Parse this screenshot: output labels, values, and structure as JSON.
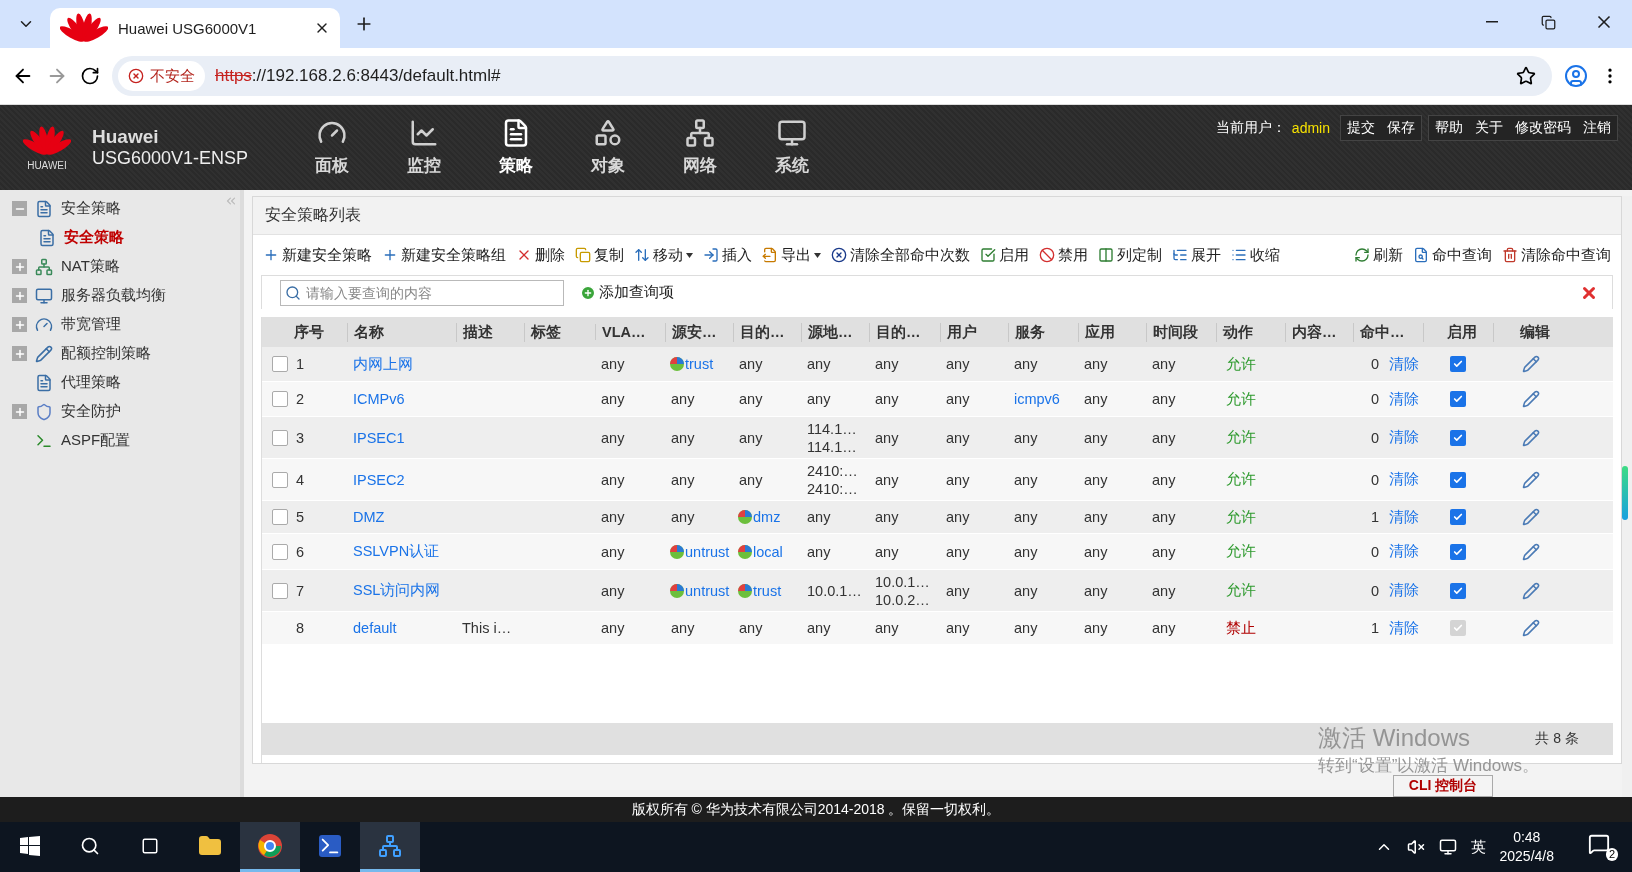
{
  "browser": {
    "tab": {
      "title": "Huawei USG6000V1"
    },
    "security_label": "不安全",
    "url_scheme": "https",
    "url_rest": "://192.168.2.6:8443/default.html#"
  },
  "header": {
    "brand": "Huawei",
    "logo_caption": "HUAWEI",
    "model": "USG6000V1-ENSP",
    "nav": [
      {
        "label": "面板",
        "selected": false
      },
      {
        "label": "监控",
        "selected": false
      },
      {
        "label": "策略",
        "selected": true
      },
      {
        "label": "对象",
        "selected": false
      },
      {
        "label": "网络",
        "selected": false
      },
      {
        "label": "系统",
        "selected": false
      }
    ],
    "user_label": "当前用户：",
    "user": "admin",
    "link_groups": [
      [
        "提交",
        "保存"
      ],
      [
        "帮助",
        "关于",
        "修改密码",
        "注销"
      ]
    ]
  },
  "sidebar": {
    "items": [
      {
        "label": "安全策略",
        "expanded": true,
        "selected": false,
        "children": [
          {
            "label": "安全策略",
            "selected": true
          }
        ]
      },
      {
        "label": "NAT策略",
        "expanded": false,
        "selected": false
      },
      {
        "label": "服务器负载均衡",
        "expanded": false,
        "selected": false
      },
      {
        "label": "带宽管理",
        "expanded": false,
        "selected": false
      },
      {
        "label": "配额控制策略",
        "expanded": false,
        "selected": false
      },
      {
        "label": "代理策略",
        "selected": false
      },
      {
        "label": "安全防护",
        "expanded": false,
        "selected": false
      },
      {
        "label": "ASPF配置",
        "selected": false
      }
    ]
  },
  "panel": {
    "title": "安全策略列表",
    "toolbar": {
      "left": [
        {
          "label": "新建安全策略",
          "has_menu": false
        },
        {
          "label": "新建安全策略组",
          "has_menu": false
        },
        {
          "label": "删除",
          "has_menu": false
        },
        {
          "label": "复制",
          "has_menu": false
        },
        {
          "label": "移动",
          "has_menu": true
        },
        {
          "label": "插入",
          "has_menu": false
        },
        {
          "label": "导出",
          "has_menu": true
        },
        {
          "label": "清除全部命中次数",
          "has_menu": false
        },
        {
          "label": "启用",
          "has_menu": false
        },
        {
          "label": "禁用",
          "has_menu": false
        },
        {
          "label": "列定制",
          "has_menu": false
        },
        {
          "label": "展开",
          "has_menu": false
        },
        {
          "label": "收缩",
          "has_menu": false
        }
      ],
      "right": [
        {
          "label": "刷新",
          "has_menu": false
        },
        {
          "label": "命中查询",
          "has_menu": false
        },
        {
          "label": "清除命中查询",
          "has_menu": false
        }
      ]
    },
    "search": {
      "placeholder": "请输入要查询的内容"
    },
    "add_query": "添加查询项",
    "table": {
      "columns": [
        "序号",
        "名称",
        "描述",
        "标签",
        "VLA…",
        "源安…",
        "目的…",
        "源地…",
        "目的…",
        "用户",
        "服务",
        "应用",
        "时间段",
        "动作",
        "内容…",
        "命中…",
        "启用",
        "编辑"
      ],
      "rows": [
        {
          "checkbox": {
            "checked": false
          },
          "cells": [
            {
              "kind": "plain",
              "text": "1"
            },
            {
              "kind": "link",
              "text": "内网上网"
            },
            {
              "kind": "empty"
            },
            {
              "kind": "empty"
            },
            {
              "kind": "plain",
              "text": "any"
            },
            {
              "kind": "zone",
              "text": "trust"
            },
            {
              "kind": "plain",
              "text": "any"
            },
            {
              "kind": "plain",
              "text": "any"
            },
            {
              "kind": "plain",
              "text": "any"
            },
            {
              "kind": "plain",
              "text": "any"
            },
            {
              "kind": "plain",
              "text": "any"
            },
            {
              "kind": "plain",
              "text": "any"
            },
            {
              "kind": "plain",
              "text": "any"
            },
            {
              "kind": "permit",
              "text": "允许"
            },
            {
              "kind": "empty"
            },
            {
              "kind": "hits",
              "count": "0",
              "link": "清除"
            },
            {
              "kind": "toggle",
              "checked": true,
              "disabled": false
            },
            {
              "kind": "edit"
            }
          ]
        },
        {
          "checkbox": {
            "checked": false
          },
          "cells": [
            {
              "kind": "plain",
              "text": "2"
            },
            {
              "kind": "link",
              "text": "ICMPv6"
            },
            {
              "kind": "empty"
            },
            {
              "kind": "empty"
            },
            {
              "kind": "plain",
              "text": "any"
            },
            {
              "kind": "plain",
              "text": "any"
            },
            {
              "kind": "plain",
              "text": "any"
            },
            {
              "kind": "plain",
              "text": "any"
            },
            {
              "kind": "plain",
              "text": "any"
            },
            {
              "kind": "plain",
              "text": "any"
            },
            {
              "kind": "link",
              "text": "icmpv6"
            },
            {
              "kind": "plain",
              "text": "any"
            },
            {
              "kind": "plain",
              "text": "any"
            },
            {
              "kind": "permit",
              "text": "允许"
            },
            {
              "kind": "empty"
            },
            {
              "kind": "hits",
              "count": "0",
              "link": "清除"
            },
            {
              "kind": "toggle",
              "checked": true,
              "disabled": false
            },
            {
              "kind": "edit"
            }
          ]
        },
        {
          "checkbox": {
            "checked": false
          },
          "cells": [
            {
              "kind": "plain",
              "text": "3"
            },
            {
              "kind": "link",
              "text": "IPSEC1"
            },
            {
              "kind": "empty"
            },
            {
              "kind": "empty"
            },
            {
              "kind": "plain",
              "text": "any"
            },
            {
              "kind": "plain",
              "text": "any"
            },
            {
              "kind": "plain",
              "text": "any"
            },
            {
              "kind": "lines",
              "lines": [
                "114.1…",
                "114.1…"
              ]
            },
            {
              "kind": "plain",
              "text": "any"
            },
            {
              "kind": "plain",
              "text": "any"
            },
            {
              "kind": "plain",
              "text": "any"
            },
            {
              "kind": "plain",
              "text": "any"
            },
            {
              "kind": "plain",
              "text": "any"
            },
            {
              "kind": "permit",
              "text": "允许"
            },
            {
              "kind": "empty"
            },
            {
              "kind": "hits",
              "count": "0",
              "link": "清除"
            },
            {
              "kind": "toggle",
              "checked": true,
              "disabled": false
            },
            {
              "kind": "edit"
            }
          ]
        },
        {
          "checkbox": {
            "checked": false
          },
          "cells": [
            {
              "kind": "plain",
              "text": "4"
            },
            {
              "kind": "link",
              "text": "IPSEC2"
            },
            {
              "kind": "empty"
            },
            {
              "kind": "empty"
            },
            {
              "kind": "plain",
              "text": "any"
            },
            {
              "kind": "plain",
              "text": "any"
            },
            {
              "kind": "plain",
              "text": "any"
            },
            {
              "kind": "lines",
              "lines": [
                "2410:…",
                "2410:…"
              ]
            },
            {
              "kind": "plain",
              "text": "any"
            },
            {
              "kind": "plain",
              "text": "any"
            },
            {
              "kind": "plain",
              "text": "any"
            },
            {
              "kind": "plain",
              "text": "any"
            },
            {
              "kind": "plain",
              "text": "any"
            },
            {
              "kind": "permit",
              "text": "允许"
            },
            {
              "kind": "empty"
            },
            {
              "kind": "hits",
              "count": "0",
              "link": "清除"
            },
            {
              "kind": "toggle",
              "checked": true,
              "disabled": false
            },
            {
              "kind": "edit"
            }
          ]
        },
        {
          "checkbox": {
            "checked": false
          },
          "cells": [
            {
              "kind": "plain",
              "text": "5"
            },
            {
              "kind": "link",
              "text": "DMZ"
            },
            {
              "kind": "empty"
            },
            {
              "kind": "empty"
            },
            {
              "kind": "plain",
              "text": "any"
            },
            {
              "kind": "plain",
              "text": "any"
            },
            {
              "kind": "zone",
              "text": "dmz"
            },
            {
              "kind": "plain",
              "text": "any"
            },
            {
              "kind": "plain",
              "text": "any"
            },
            {
              "kind": "plain",
              "text": "any"
            },
            {
              "kind": "plain",
              "text": "any"
            },
            {
              "kind": "plain",
              "text": "any"
            },
            {
              "kind": "plain",
              "text": "any"
            },
            {
              "kind": "permit",
              "text": "允许"
            },
            {
              "kind": "empty"
            },
            {
              "kind": "hits",
              "count": "1",
              "link": "清除"
            },
            {
              "kind": "toggle",
              "checked": true,
              "disabled": false
            },
            {
              "kind": "edit"
            }
          ]
        },
        {
          "checkbox": {
            "checked": false
          },
          "cells": [
            {
              "kind": "plain",
              "text": "6"
            },
            {
              "kind": "link",
              "text": "SSLVPN认证"
            },
            {
              "kind": "empty"
            },
            {
              "kind": "empty"
            },
            {
              "kind": "plain",
              "text": "any"
            },
            {
              "kind": "zone",
              "text": "untrust"
            },
            {
              "kind": "zone",
              "text": "local"
            },
            {
              "kind": "plain",
              "text": "any"
            },
            {
              "kind": "plain",
              "text": "any"
            },
            {
              "kind": "plain",
              "text": "any"
            },
            {
              "kind": "plain",
              "text": "any"
            },
            {
              "kind": "plain",
              "text": "any"
            },
            {
              "kind": "plain",
              "text": "any"
            },
            {
              "kind": "permit",
              "text": "允许"
            },
            {
              "kind": "empty"
            },
            {
              "kind": "hits",
              "count": "0",
              "link": "清除"
            },
            {
              "kind": "toggle",
              "checked": true,
              "disabled": false
            },
            {
              "kind": "edit"
            }
          ]
        },
        {
          "checkbox": {
            "checked": false
          },
          "cells": [
            {
              "kind": "plain",
              "text": "7"
            },
            {
              "kind": "link",
              "text": "SSL访问内网"
            },
            {
              "kind": "empty"
            },
            {
              "kind": "empty"
            },
            {
              "kind": "plain",
              "text": "any"
            },
            {
              "kind": "zone",
              "text": "untrust"
            },
            {
              "kind": "zone",
              "text": "trust"
            },
            {
              "kind": "plain",
              "text": "10.0.1…"
            },
            {
              "kind": "lines",
              "lines": [
                "10.0.1…",
                "10.0.2…"
              ]
            },
            {
              "kind": "plain",
              "text": "any"
            },
            {
              "kind": "plain",
              "text": "any"
            },
            {
              "kind": "plain",
              "text": "any"
            },
            {
              "kind": "plain",
              "text": "any"
            },
            {
              "kind": "permit",
              "text": "允许"
            },
            {
              "kind": "empty"
            },
            {
              "kind": "hits",
              "count": "0",
              "link": "清除"
            },
            {
              "kind": "toggle",
              "checked": true,
              "disabled": false
            },
            {
              "kind": "edit"
            }
          ]
        },
        {
          "cells": [
            {
              "kind": "plain",
              "text": "8"
            },
            {
              "kind": "link",
              "text": "default"
            },
            {
              "kind": "plain",
              "text": "This i…"
            },
            {
              "kind": "empty"
            },
            {
              "kind": "plain",
              "text": "any"
            },
            {
              "kind": "plain",
              "text": "any"
            },
            {
              "kind": "plain",
              "text": "any"
            },
            {
              "kind": "plain",
              "text": "any"
            },
            {
              "kind": "plain",
              "text": "any"
            },
            {
              "kind": "plain",
              "text": "any"
            },
            {
              "kind": "plain",
              "text": "any"
            },
            {
              "kind": "plain",
              "text": "any"
            },
            {
              "kind": "plain",
              "text": "any"
            },
            {
              "kind": "deny",
              "text": "禁止"
            },
            {
              "kind": "empty"
            },
            {
              "kind": "hits",
              "count": "1",
              "link": "清除"
            },
            {
              "kind": "toggle",
              "checked": true,
              "disabled": true
            },
            {
              "kind": "edit"
            }
          ]
        }
      ]
    },
    "total": "共 8 条"
  },
  "cli_button": "CLI 控制台",
  "activation": {
    "title": "激活 Windows",
    "hint": "转到“设置”以激活 Windows。"
  },
  "copyright": "版权所有 © 华为技术有限公司2014-2018 。保留一切权利。",
  "taskbar": {
    "apps": [
      {
        "selected": false
      },
      {
        "selected": true
      },
      {
        "selected": false
      },
      {
        "selected": true
      }
    ],
    "tray": {
      "ime": "英",
      "time": "0:48",
      "date": "2025/4/8",
      "notifications": "2"
    }
  }
}
